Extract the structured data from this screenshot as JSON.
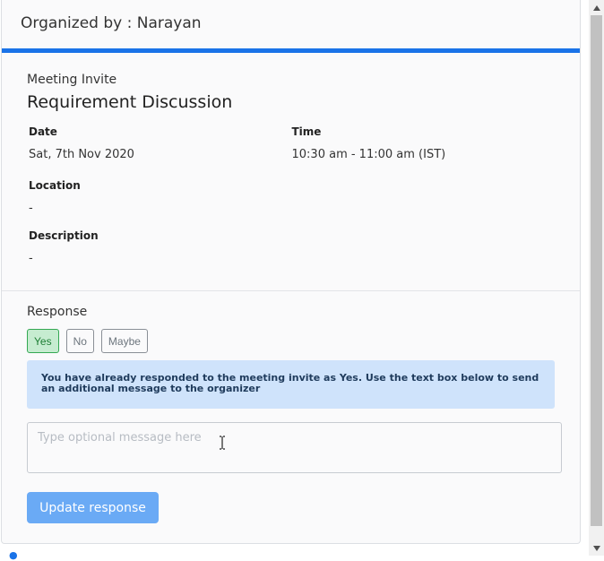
{
  "header": {
    "organizer_text": "Organized by : Narayan"
  },
  "details": {
    "kind_label": "Meeting Invite",
    "title": "Requirement Discussion",
    "date_label": "Date",
    "date_value": "Sat, 7th Nov 2020",
    "time_label": "Time",
    "time_value": "10:30 am - 11:00 am (IST)",
    "location_label": "Location",
    "location_value": "-",
    "description_label": "Description",
    "description_value": "-"
  },
  "response": {
    "label": "Response",
    "options": [
      {
        "label": "Yes",
        "selected": true
      },
      {
        "label": "No",
        "selected": false
      },
      {
        "label": "Maybe",
        "selected": false
      }
    ],
    "alert_text": "You have already responded to the meeting invite as Yes. Use the text box below to send an additional message to the organizer",
    "message_placeholder": "Type optional message here",
    "message_value": "",
    "submit_label": "Update response"
  },
  "colors": {
    "accent": "#1a73e8",
    "selected_bg": "#c6ecd0",
    "selected_border": "#34a853",
    "alert_bg": "#cfe3fb",
    "submit_bg": "#6aaaf5"
  },
  "icons": {
    "scroll_up": "triangle-up-icon",
    "scroll_down": "triangle-down-icon",
    "text_cursor": "ibeam-cursor-icon"
  }
}
